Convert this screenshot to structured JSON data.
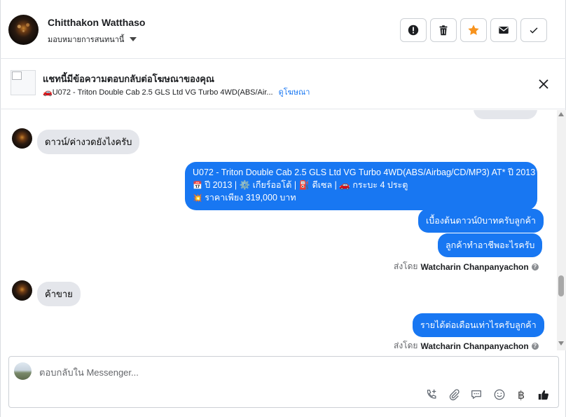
{
  "header": {
    "contact_name": "Chitthakon Watthaso",
    "assign_label": "มอบหมายการสนทนานี้",
    "actions": [
      {
        "name": "report",
        "icon": "exclamation-icon"
      },
      {
        "name": "delete",
        "icon": "trash-icon"
      },
      {
        "name": "star",
        "icon": "star-icon",
        "color": "#f7931e"
      },
      {
        "name": "mail",
        "icon": "envelope-icon"
      },
      {
        "name": "done",
        "icon": "check-icon"
      }
    ]
  },
  "ad_banner": {
    "title": "แชทนี้มีข้อความตอบกลับต่อโฆษณาของคุณ",
    "subtitle": "U072 - Triton Double Cab 2.5 GLS Ltd VG Turbo 4WD(ABS/Air...",
    "link": "ดูโฆษณา"
  },
  "messages": {
    "m1": "ดาวน์/ค่างวดยังไงครับ",
    "m2_line1": "U072 - Triton Double Cab 2.5 GLS Ltd VG Turbo 4WD(ABS/Airbag/CD/MP3) AT* ปี 2013",
    "m2_line2": "ปี 2013 | ⚙️ เกียร์ออโต้ | ⛽ ดีเซล | 🚗 กระบะ 4 ประตู",
    "m2_line3": "ราคาเพียง 319,000 บาท",
    "m3": "เบื้องต้นดาวน์0บาทครับลูกค้า",
    "m4": "ลูกค้าทำอาชีพอะไรครับ",
    "m5": "ค้าขาย",
    "m6": "รายได้ต่อเดือนเท่าไรครับลูกค้า"
  },
  "sent_by": {
    "prefix": "ส่งโดย",
    "agent": "Watcharin Chanpanyachon"
  },
  "composer": {
    "placeholder": "ตอบกลับใน Messenger...",
    "tools": [
      "phone-add-icon",
      "paperclip-icon",
      "chat-bubble-icon",
      "smiley-icon",
      "baht-icon",
      "thumbs-up-icon"
    ],
    "baht_symbol": "฿"
  },
  "colors": {
    "accent": "#1877f2",
    "incoming_bubble": "#e4e6eb",
    "star": "#f7931e"
  }
}
